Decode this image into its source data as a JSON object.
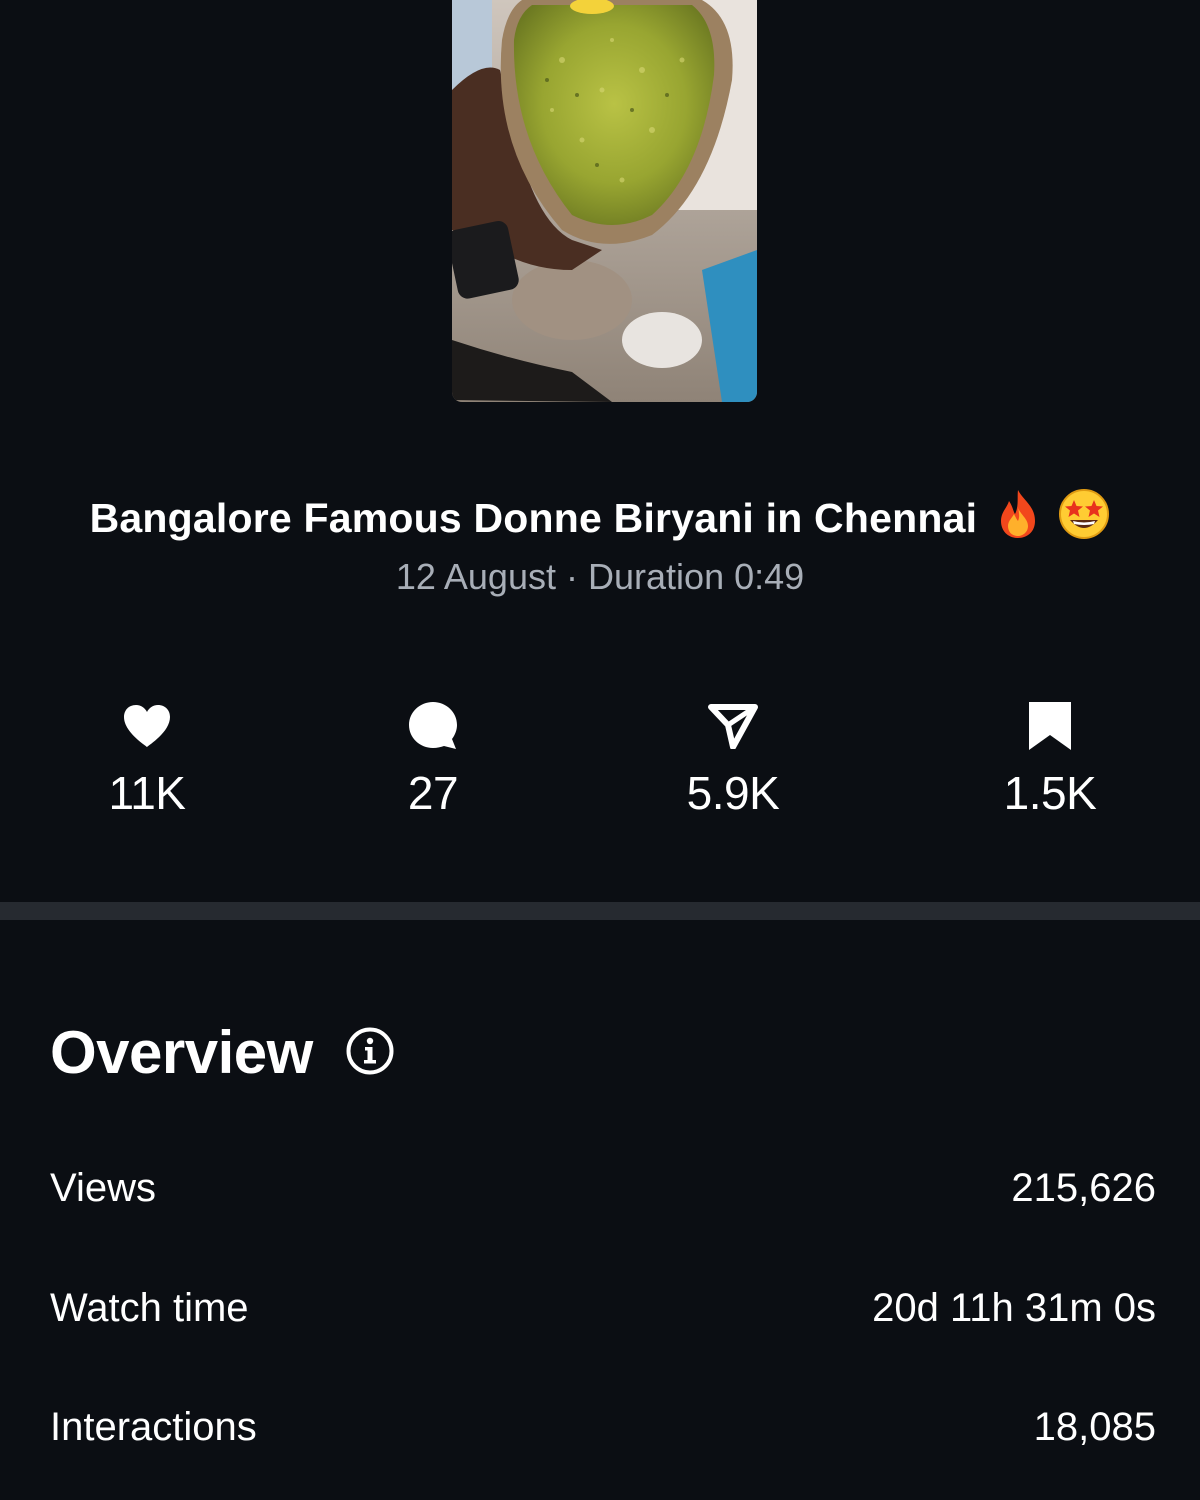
{
  "video": {
    "title": "Bangalore Famous Donne Biryani in Chennai",
    "title_emojis": [
      "fire-emoji",
      "star-struck-emoji"
    ],
    "date": "12 August",
    "separator": "·",
    "duration_label": "Duration 0:49"
  },
  "stats": {
    "likes": {
      "icon": "heart-icon",
      "value": "11K"
    },
    "comments": {
      "icon": "comment-icon",
      "value": "27"
    },
    "shares": {
      "icon": "send-icon",
      "value": "5.9K"
    },
    "saves": {
      "icon": "bookmark-icon",
      "value": "1.5K"
    }
  },
  "overview": {
    "title": "Overview",
    "info_icon": "info-icon",
    "rows": [
      {
        "label": "Views",
        "value": "215,626"
      },
      {
        "label": "Watch time",
        "value": "20d 11h 31m 0s"
      },
      {
        "label": "Interactions",
        "value": "18,085"
      }
    ]
  },
  "colors": {
    "background": "#0b0e13",
    "text": "#ffffff",
    "secondary_text": "#a8aeb7",
    "divider": "#262a30"
  }
}
